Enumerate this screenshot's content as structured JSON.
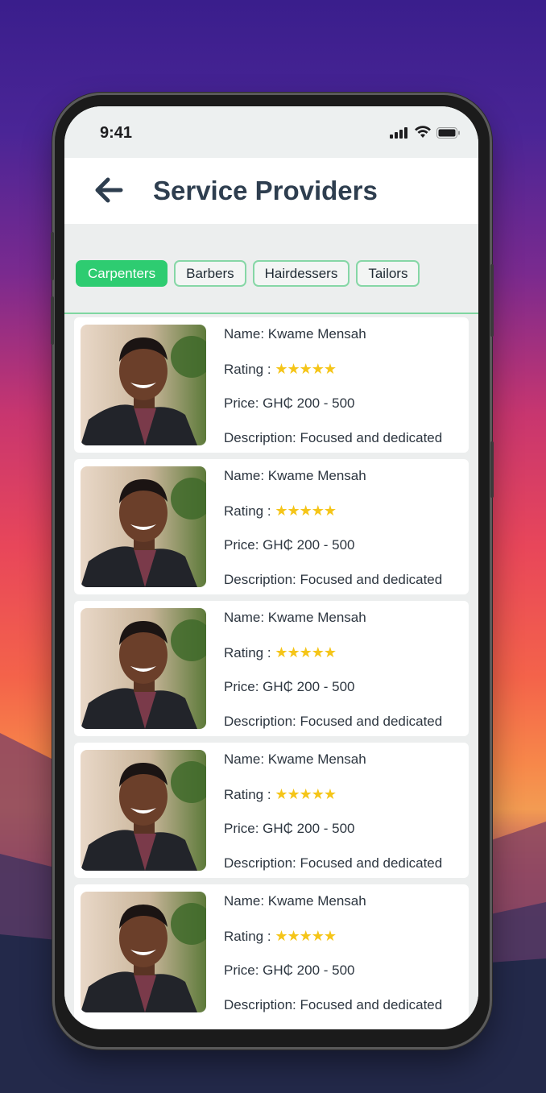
{
  "status_bar": {
    "time": "9:41"
  },
  "header": {
    "title": "Service Providers"
  },
  "categories": [
    {
      "label": "Carpenters",
      "active": true
    },
    {
      "label": "Barbers",
      "active": false
    },
    {
      "label": "Hairdessers",
      "active": false
    },
    {
      "label": "Tailors",
      "active": false
    }
  ],
  "providers": [
    {
      "name": "Name: Kwame Mensah",
      "rating_label": "Rating : ",
      "stars": "★★★★★",
      "rating": 5,
      "price": "Price: GH₵ 200 - 500",
      "description": "Description: Focused and dedicated"
    },
    {
      "name": "Name: Kwame Mensah",
      "rating_label": "Rating : ",
      "stars": "★★★★★",
      "rating": 5,
      "price": "Price: GH₵ 200 - 500",
      "description": "Description: Focused and dedicated"
    },
    {
      "name": "Name: Kwame Mensah",
      "rating_label": "Rating : ",
      "stars": "★★★★★",
      "rating": 5,
      "price": "Price: GH₵ 200 - 500",
      "description": "Description: Focused and dedicated"
    },
    {
      "name": "Name: Kwame Mensah",
      "rating_label": "Rating : ",
      "stars": "★★★★★",
      "rating": 5,
      "price": "Price: GH₵ 200 - 500",
      "description": "Description: Focused and dedicated"
    },
    {
      "name": "Name: Kwame Mensah",
      "rating_label": "Rating : ",
      "stars": "★★★★★",
      "rating": 5,
      "price": "Price: GH₵ 200 - 500",
      "description": "Description: Focused and dedicated"
    }
  ],
  "icons": {
    "back": "back-arrow-icon",
    "signal": "cellular-signal-icon",
    "wifi": "wifi-icon",
    "battery": "battery-icon"
  },
  "colors": {
    "accent": "#2ecc71",
    "chip_border": "#86d7a6",
    "title": "#2e3e4f",
    "star": "#f5c518"
  }
}
